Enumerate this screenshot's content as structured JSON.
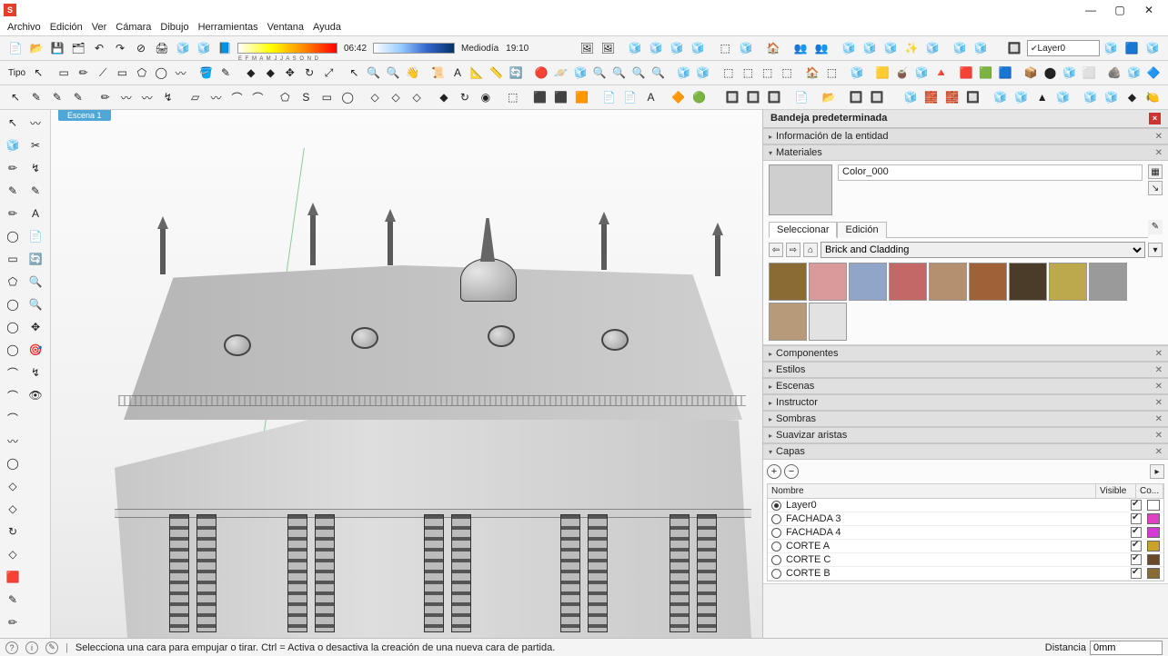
{
  "menu": [
    "Archivo",
    "Edición",
    "Ver",
    "Cámara",
    "Dibujo",
    "Herramientas",
    "Ventana",
    "Ayuda"
  ],
  "window": {
    "min": "—",
    "max": "▢",
    "close": "✕"
  },
  "toolbar": {
    "tipo_label": "Tipo",
    "months_label": "E F M A M J J A S O N D",
    "time_a": "06:42",
    "time_mid": "Mediodía",
    "time_b": "19:10",
    "layer_field": "Layer0"
  },
  "scene_tab": "Escena 1",
  "tray": {
    "title": "Bandeja predeterminada",
    "panels": {
      "entity": "Información de la entidad",
      "materials": "Materiales",
      "components": "Componentes",
      "styles": "Estilos",
      "scenes": "Escenas",
      "instructor": "Instructor",
      "shadows": "Sombras",
      "soften": "Suavizar aristas",
      "layers": "Capas"
    },
    "mat": {
      "name": "Color_000",
      "tab_select": "Seleccionar",
      "tab_edit": "Edición",
      "category": "Brick and Cladding",
      "swatches": [
        "#8a6b33",
        "#d89a9a",
        "#8fa6c8",
        "#c46767",
        "#b49070",
        "#9e6236",
        "#4a3c28",
        "#bca84d",
        "#9a9a9a",
        "#b79a7a",
        "#e2e2e2"
      ]
    },
    "layers": {
      "col_name": "Nombre",
      "col_visible": "Visible",
      "col_color": "Co...",
      "rows": [
        {
          "name": "Layer0",
          "active": true,
          "visible": true,
          "color": "#ffffff"
        },
        {
          "name": "FACHADA 3",
          "active": false,
          "visible": true,
          "color": "#e042c4"
        },
        {
          "name": "FACHADA 4",
          "active": false,
          "visible": true,
          "color": "#d43ad4"
        },
        {
          "name": "CORTE A",
          "active": false,
          "visible": true,
          "color": "#c9a227"
        },
        {
          "name": "CORTE C",
          "active": false,
          "visible": true,
          "color": "#6b4a2a"
        },
        {
          "name": "CORTE B",
          "active": false,
          "visible": true,
          "color": "#8a6b33"
        }
      ]
    }
  },
  "status": {
    "hint": "Selecciona una cara para empujar o tirar. Ctrl = Activa o desactiva la creación de una nueva cara de partida.",
    "dist_label": "Distancia",
    "dist_value": "0mm"
  },
  "icons": {
    "row1": [
      "📄",
      "📂",
      "💾",
      "🗂",
      "↶",
      "↷",
      "⊘",
      "🖨",
      "🧊",
      "🧊",
      "📘",
      "",
      "",
      "",
      "",
      "",
      "",
      "",
      "🖼",
      "🖼",
      "",
      "🧊",
      "🧊",
      "🧊",
      "🧊",
      "",
      "⬚",
      "🧊",
      "",
      "🏠",
      "",
      "👥",
      "👥",
      "",
      "🧊",
      "🧊",
      "🧊",
      "✨",
      "🧊",
      "",
      "🧊",
      "🧊",
      "",
      "",
      "🔲"
    ],
    "row2": [
      "▭",
      "✏",
      "⟋",
      "▭",
      "⬠",
      "◯",
      "〰",
      "",
      "🪣",
      "✎",
      "",
      "◆",
      "◆",
      "✥",
      "↻",
      "⤢",
      "",
      "↖",
      "🔍",
      "🔍",
      "👋",
      "",
      "📜",
      "A",
      "📐",
      "📏",
      "🔄",
      "",
      "🔴",
      "🪐",
      "🧊",
      "🔍",
      "🔍",
      "🔍",
      "🔍",
      "",
      "🧊",
      "🧊",
      "",
      "⬚",
      "⬚",
      "⬚",
      "⬚",
      "",
      "🏠",
      "⬚",
      "",
      "🧊",
      "",
      "🟨",
      "🧉",
      "🧊",
      "🔺",
      "",
      "🟥",
      "🟩",
      "🟦",
      "",
      "📦",
      "⬤",
      "🧊",
      "⬜",
      "",
      "🪨",
      "🧊",
      "🔷"
    ],
    "row3": [
      "↖",
      "✎",
      "✎",
      "✎",
      "",
      "✏",
      "〰",
      "〰",
      "↯",
      "",
      "▱",
      "〰",
      "⌒",
      "⌒",
      "",
      "⬠",
      "S",
      "▭",
      "◯",
      "",
      "◇",
      "◇",
      "◇",
      "",
      "◆",
      "↻",
      "◉",
      "",
      "⬚",
      "",
      "⬛",
      "⬛",
      "🟧",
      "",
      "📄",
      "📄",
      "A",
      "",
      "🔶",
      "🟢",
      "",
      "",
      "🔲",
      "🔲",
      "🔲",
      "",
      "📄",
      "",
      "📂",
      "",
      "🔲",
      "🔲",
      "",
      "",
      "🧊",
      "🧱",
      "🧱",
      "🔲",
      "",
      "🧊",
      "🧊",
      "▲",
      "🧊",
      "",
      "🧊",
      "🧊",
      "◆",
      "🍋"
    ],
    "left": [
      "↖",
      "🧊",
      "✏",
      "✎",
      "✏",
      "◯",
      "▭",
      "⬠",
      "◯",
      "◯",
      "◯",
      "⌒",
      "⌒",
      "⌒",
      "〰",
      "◯",
      "◇",
      "◇",
      "↻",
      "◇",
      "🟥",
      "✎",
      "✏",
      "〰",
      "✂",
      "↯",
      "✎",
      "A",
      "📄",
      "🔄",
      "🔍",
      "🔍",
      "✥",
      "🎯",
      "↯",
      "👁"
    ]
  }
}
